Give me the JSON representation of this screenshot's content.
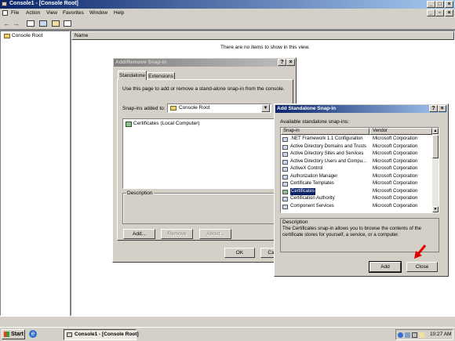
{
  "main_window": {
    "title": "Console1 - [Console Root]",
    "menu": [
      "File",
      "Action",
      "View",
      "Favorites",
      "Window",
      "Help"
    ],
    "tree_root": "Console Root",
    "list_header": "Name",
    "empty_message": "There are no items to show in this view."
  },
  "add_remove_dialog": {
    "title": "Add/Remove Snap-in",
    "tabs": [
      "Standalone",
      "Extensions"
    ],
    "instruction": "Use this page to add or remove a stand-alone snap-in from the console.",
    "snapins_added_label": "Snap-ins added to:",
    "snapins_added_value": "Console Root",
    "items": [
      "Certificates (Local Computer)"
    ],
    "description_label": "Description",
    "buttons": {
      "add": "Add...",
      "remove": "Remove",
      "about": "About...",
      "ok": "OK",
      "cancel": "Cancel"
    }
  },
  "add_standalone_dialog": {
    "title": "Add Standalone Snap-in",
    "available_label": "Available standalone snap-ins:",
    "columns": {
      "snapin": "Snap-in",
      "vendor": "Vendor"
    },
    "rows": [
      {
        "name": ".NET Framework 1.1 Configuration",
        "vendor": "Microsoft Corporation"
      },
      {
        "name": "Active Directory Domains and Trusts",
        "vendor": "Microsoft Corporation"
      },
      {
        "name": "Active Directory Sites and Services",
        "vendor": "Microsoft Corporation"
      },
      {
        "name": "Active Directory Users and Compu...",
        "vendor": "Microsoft Corporation"
      },
      {
        "name": "ActiveX Control",
        "vendor": "Microsoft Corporation"
      },
      {
        "name": "Authorization Manager",
        "vendor": "Microsoft Corporation"
      },
      {
        "name": "Certificate Templates",
        "vendor": "Microsoft Corporation"
      },
      {
        "name": "Certificates",
        "vendor": "Microsoft Corporation"
      },
      {
        "name": "Certification Authority",
        "vendor": "Microsoft Corporation"
      },
      {
        "name": "Component Services",
        "vendor": "Microsoft Corporation"
      }
    ],
    "selected_index": 7,
    "description_label": "Description",
    "description_text": "The Certificates snap-in allows you to browse the contents of the certificate stores for yourself, a service, or a computer.",
    "buttons": {
      "add": "Add",
      "close": "Close"
    }
  },
  "taskbar": {
    "start_label": "Start",
    "task_label": "Console1 - [Console Root]",
    "clock": "10:27 AM"
  },
  "colors": {
    "active_title": "#0a246a",
    "face": "#d4d0c8",
    "annotation_arrow": "#e00000"
  }
}
